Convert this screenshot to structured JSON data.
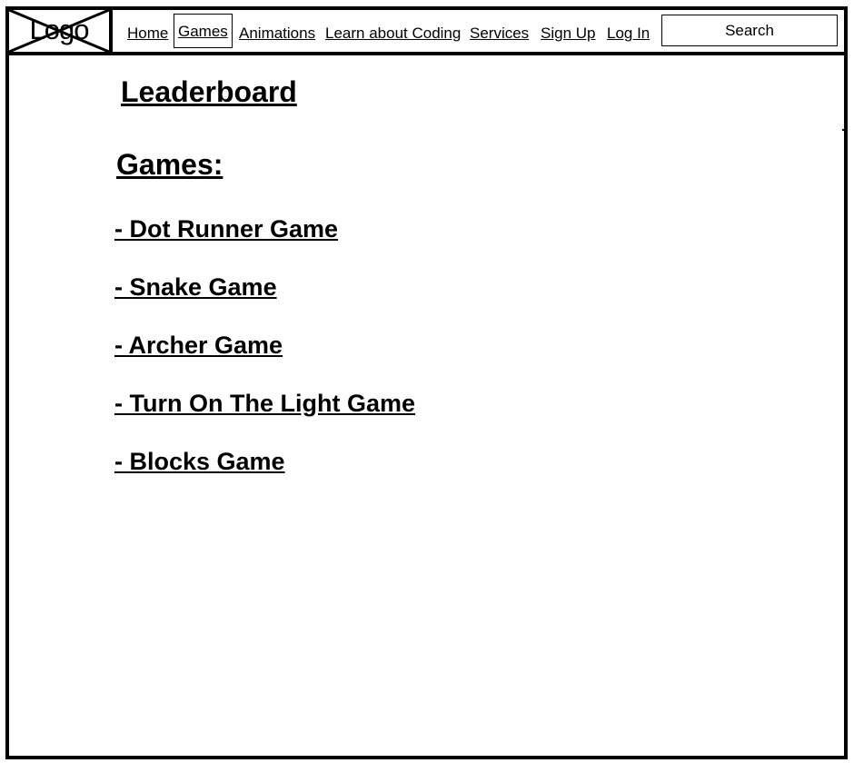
{
  "header": {
    "logo_text": "Logo",
    "nav": {
      "home": "Home",
      "games": "Games",
      "animations": "Animations",
      "learn": "Learn about Coding",
      "services": "Services",
      "signup": "Sign Up",
      "login": "Log In"
    },
    "search_label": "Search",
    "active_nav": "Games"
  },
  "main": {
    "title": "Leaderboard",
    "games_heading": "Games:",
    "games": [
      "- Dot Runner Game",
      "- Snake Game",
      "- Archer Game",
      "- Turn On The Light Game",
      "- Blocks Game"
    ]
  }
}
